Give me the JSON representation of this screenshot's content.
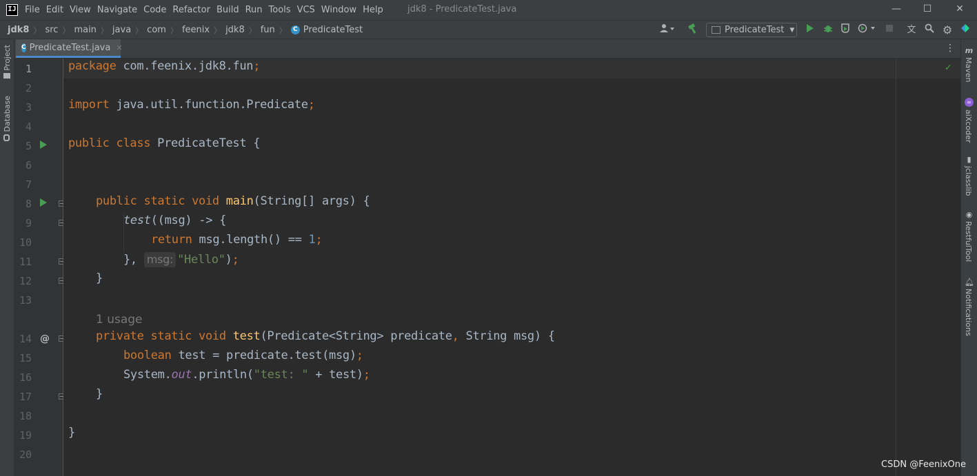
{
  "window": {
    "title": "jdk8 - PredicateTest.java",
    "logo": "IJ",
    "menu": [
      "File",
      "Edit",
      "View",
      "Navigate",
      "Code",
      "Refactor",
      "Build",
      "Run",
      "Tools",
      "VCS",
      "Window",
      "Help"
    ],
    "minimize": "—",
    "maximize": "☐",
    "close": "✕"
  },
  "breadcrumb": [
    "jdk8",
    "src",
    "main",
    "java",
    "com",
    "feenix",
    "jdk8",
    "fun",
    "PredicateTest"
  ],
  "toolbar": {
    "run_config": "PredicateTest",
    "icons": [
      "user-icon",
      "build-hammer-icon",
      "run-icon",
      "debug-icon",
      "coverage-icon",
      "profile-icon",
      "stop-icon",
      "translate-icon",
      "search-icon",
      "settings-icon",
      "toolbox-icon"
    ]
  },
  "left_tools": [
    "Project",
    "Database"
  ],
  "right_tools": [
    "Maven",
    "aiXcoder",
    "jclasslib",
    "RestfulTool",
    "Notifications"
  ],
  "editor_tab": {
    "label": "PredicateTest.java",
    "close": "✕"
  },
  "line_numbers": [
    "1",
    "2",
    "3",
    "4",
    "5",
    "6",
    "7",
    "8",
    "9",
    "10",
    "11",
    "12",
    "13",
    "14",
    "15",
    "16",
    "17",
    "18",
    "19",
    "20"
  ],
  "code": {
    "l1_kw": "package",
    "l1_rest": " com.feenix.jdk8.fun",
    "l1_semi": ";",
    "l3_kw": "import",
    "l3_rest": " java.util.function.Predicate",
    "l3_semi": ";",
    "l5_kw": "public class",
    "l5_rest": " PredicateTest {",
    "l8_kw": "public static void",
    "l8_fn": "main",
    "l8_rest": "(String[] args) {",
    "l9_call": "test",
    "l9_rest": "((msg) -> {",
    "l10_kw": "return",
    "l10_rest": " msg.length() == ",
    "l10_num": "1",
    "l10_semi": ";",
    "l11_a": "}, ",
    "l11_hint": "msg:",
    "l11_str": "\"Hello\"",
    "l11_end": ")",
    "l11_semi": ";",
    "l12": "}",
    "usage": "1 usage",
    "l14_kw": "private static void",
    "l14_fn": "test",
    "l14_a": "(Predicate<String> predicate",
    "l14_comma": ",",
    "l14_b": " String msg) {",
    "l15_kw": "boolean",
    "l15_rest": " test = predicate.test(msg)",
    "l15_semi": ";",
    "l16_a": "System.",
    "l16_field": "out",
    "l16_b": ".println(",
    "l16_str": "\"test: \"",
    "l16_c": " + test)",
    "l16_semi": ";",
    "l17": "}",
    "l19": "}"
  },
  "inspection_status": "✓",
  "watermark": "CSDN @FeenixOne",
  "colors": {
    "keyword": "#cc7832",
    "function": "#ffc66d",
    "number": "#6897bb",
    "string": "#6a8759",
    "field": "#9876aa",
    "text": "#a9b7c6"
  }
}
